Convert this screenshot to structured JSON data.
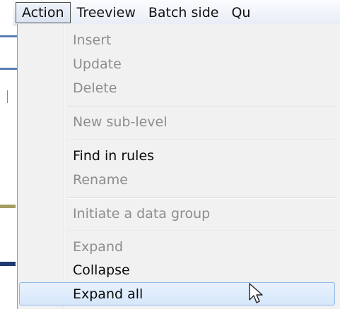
{
  "menubar": {
    "items": [
      {
        "label": "Action",
        "active": true
      },
      {
        "label": "Treeview",
        "active": false
      },
      {
        "label": "Batch side",
        "active": false
      },
      {
        "label": "Qu",
        "active": false
      }
    ]
  },
  "menu": {
    "items": [
      {
        "label": "Insert",
        "enabled": false
      },
      {
        "label": "Update",
        "enabled": false
      },
      {
        "label": "Delete",
        "enabled": false
      },
      {
        "label": "New sub-level",
        "enabled": false
      },
      {
        "label": "Find in rules",
        "enabled": true
      },
      {
        "label": "Rename",
        "enabled": false
      },
      {
        "label": "Initiate a data group",
        "enabled": false
      },
      {
        "label": "Expand",
        "enabled": false
      },
      {
        "label": "Collapse",
        "enabled": true
      },
      {
        "label": "Expand all",
        "enabled": true,
        "hovered": true
      }
    ]
  },
  "colors": {
    "disabled_text": "#8d8d8d",
    "enabled_text": "#0a0a0a",
    "hover_border": "#8fb7e6",
    "menu_background": "#f1f1f1"
  },
  "icons": {
    "cursor": "mouse-pointer-icon"
  }
}
